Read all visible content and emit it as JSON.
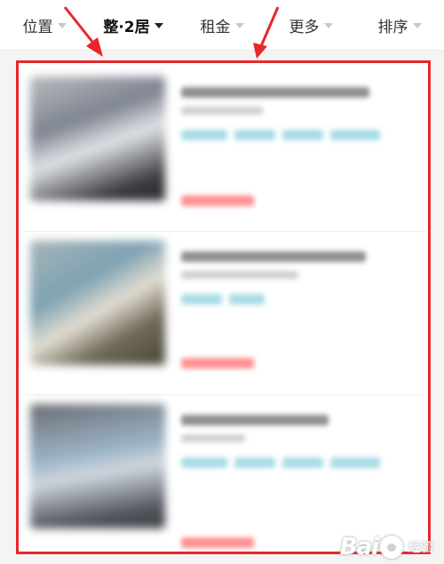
{
  "filters": [
    {
      "label": "位置",
      "active": false
    },
    {
      "label": "整·2居",
      "active": true
    },
    {
      "label": "租金",
      "active": false
    },
    {
      "label": "更多",
      "active": false
    },
    {
      "label": "排序",
      "active": false
    }
  ],
  "colors": {
    "annotation_red": "#e8262a",
    "tag_blue": "#a8dce6",
    "price_red": "#ff8f90"
  },
  "watermark": {
    "brand": "Bai",
    "suffix": "经验"
  },
  "icons": [
    "caret-down-icon",
    "baidu-paw-icon"
  ]
}
